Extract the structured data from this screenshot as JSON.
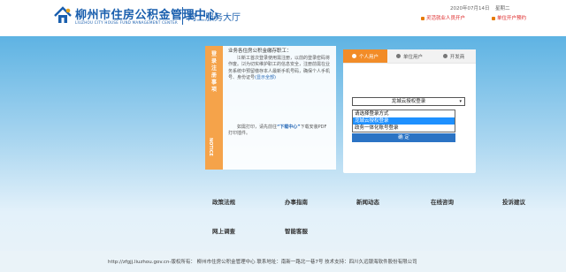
{
  "header": {
    "logo_title": "柳州市住房公积金管理中心",
    "logo_subtitle": "LIUZHOU CITY HOUSE FUND MANAGEMENT CENTER",
    "service_hall": "网上服务大厅",
    "date": "2020年07月14日",
    "weekday": "星期二",
    "link_unemployed": "灵活就业人员开户",
    "link_appointment": "单位开户预约"
  },
  "notice": {
    "vertical_title": "登录注册事项",
    "vertical_title_chars": [
      "登",
      "录",
      "注",
      "册",
      "事",
      "项"
    ],
    "label_en": "NOTICE",
    "heading": "业务各住房公积金缴存职工：",
    "paragraph1": "⑴新工首次登录使用需注册，以前的登录密码将作废。⑵为切实维护职工的信息安全，注册前需在业务系统中预留缴存本人最新手机号码，确保个人手机号、身份证号",
    "paragraph1_link": "(显示全部)",
    "print_prefix": "如需打印，请先前往",
    "print_link": "“下载中心”",
    "print_suffix": "下载安装PDF打印插件。"
  },
  "login": {
    "tabs": [
      {
        "label": "个人用户",
        "active": true
      },
      {
        "label": "单位用户",
        "active": false
      },
      {
        "label": "开发商",
        "active": false
      }
    ],
    "select_value": "龙城云授权登录",
    "dropdown_options": [
      "请选择登录方式",
      "龙城云授权登录",
      "政务一体化账号登录"
    ],
    "dropdown_selected_index": 1,
    "confirm_label": "确 定"
  },
  "nav": {
    "row1": [
      "政策法规",
      "办事指南",
      "新闻动态",
      "在线咨询",
      "投诉建议"
    ],
    "row2": [
      "网上调查",
      "智能客服"
    ]
  },
  "footer": {
    "text": "http://zfgjj.liuzhou.gov.cn-版权所有：  柳州市住房公积金管理中心 联系地址：南新一路北一巷7号 技术支持：四川久远银海软件股份有限公司"
  },
  "colors": {
    "brand_blue": "#1a5fae",
    "accent_orange": "#f28c28",
    "notice_orange": "#f5a34a",
    "selected_blue": "#1e90ff",
    "confirm_blue": "#2b73c4",
    "link_red": "#dd2222"
  }
}
